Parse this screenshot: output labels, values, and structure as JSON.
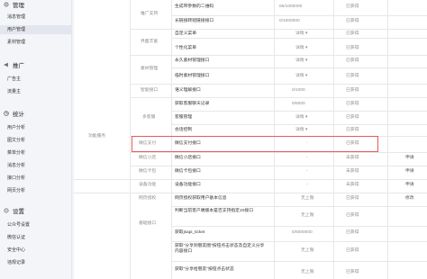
{
  "sidebar": {
    "groups": [
      {
        "title": "管理",
        "icon": "gear-icon",
        "items": [
          "消息管理",
          "用户管理",
          "素材管理"
        ]
      },
      {
        "title": "推广",
        "icon": "megaphone-icon",
        "items": [
          "广告主",
          "流量主"
        ]
      },
      {
        "title": "统计",
        "icon": "chart-icon",
        "items": [
          "用户分析",
          "图文分析",
          "菜单分析",
          "消息分析",
          "接口分析",
          "网页分析"
        ]
      },
      {
        "title": "设置",
        "icon": "settings-icon",
        "items": [
          "公众号设置",
          "微信认证",
          "安全中心",
          "违规记录"
        ]
      }
    ],
    "active_item": "用户管理"
  },
  "table": {
    "group_function_service": "功能服务",
    "rows": [
      {
        "cat": "",
        "name": "生成带参数的二维码",
        "quota": "85/1000000",
        "status": "已获得",
        "action": ""
      },
      {
        "cat": "推广支持",
        "name": "长链接转短链接接口",
        "quota": "0/1000000",
        "status": "已获得",
        "action": ""
      },
      {
        "cat": "",
        "name": "自定义菜单",
        "quota": "详情 ▾",
        "status": "已获得",
        "action": ""
      },
      {
        "cat": "界面丰富",
        "name": "个性化菜单",
        "quota": "详情 ▾",
        "status": "已获得",
        "action": ""
      },
      {
        "cat": "",
        "name": "永久素材管理接口",
        "quota": "详情 ▾",
        "status": "已获得",
        "action": ""
      },
      {
        "cat": "素材管理",
        "name": "临时素材管理接口",
        "quota": "详情 ▾",
        "status": "已获得",
        "action": ""
      },
      {
        "cat": "智能接口",
        "name": "语义理解接口",
        "quota": "0/1000",
        "status": "已获得",
        "action": ""
      },
      {
        "cat": "",
        "name": "获取客服聊天记录",
        "quota": "0/5000",
        "status": "已获得",
        "action": ""
      },
      {
        "cat": "多客服",
        "name": "客服管理",
        "quota": "详情 ▾",
        "status": "已获得",
        "action": ""
      },
      {
        "cat": "",
        "name": "会话控制",
        "quota": "详情 ▾",
        "status": "已获得",
        "action": ""
      },
      {
        "cat": "微信支付",
        "name": "微信支付接口",
        "quota": "-",
        "status": "已获得",
        "action": ""
      },
      {
        "cat": "微信小店",
        "name": "微信小店接口",
        "quota": "-",
        "status": "未获得",
        "action": "申请"
      },
      {
        "cat": "微信卡包",
        "name": "微信卡包接口",
        "quota": "-",
        "status": "未获得",
        "action": "申请"
      },
      {
        "cat": "设备功能",
        "name": "设备功能接口",
        "quota": "-",
        "status": "未获得",
        "action": "申请"
      },
      {
        "cat": "网页授权",
        "name": "网页授权获取用户基本信息",
        "quota": "无上限",
        "status": "已获得",
        "action": "修改"
      },
      {
        "cat": "",
        "name": "判断当前客户端版本是否支持指定JS接口",
        "quota": "无上限",
        "status": "已获得",
        "action": ""
      },
      {
        "cat": "基础接口",
        "name": "获取jsapi_ticket",
        "quota": "5/5000000",
        "status": "已获得",
        "action": ""
      },
      {
        "cat": "",
        "name": "获取\"分享到朋友圈\"按钮点击状态及自定义分享内容接口",
        "quota": "无上限",
        "status": "已获得",
        "action": ""
      },
      {
        "cat": "",
        "name": "获取\"分享给朋友\"按钮点击状态",
        "quota": "无上限",
        "status": "已获得",
        "action": ""
      }
    ]
  },
  "colors": {
    "highlight_border": "#e55a5a",
    "active_bg": "#e3e6ee",
    "line": "#e7e7eb"
  }
}
